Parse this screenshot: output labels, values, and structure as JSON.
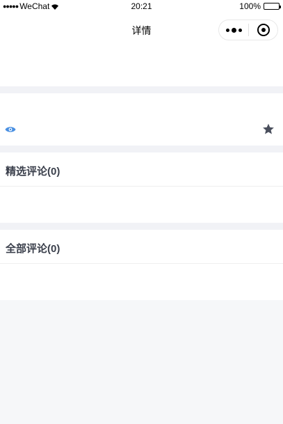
{
  "status_bar": {
    "signal": "●●●●●",
    "carrier": "WeChat",
    "time": "20:21",
    "battery": "100%"
  },
  "nav": {
    "title": "详情"
  },
  "sections": {
    "featured_comments": "精选评论(0)",
    "all_comments": "全部评论(0)"
  },
  "colors": {
    "accent": "#4a90e2",
    "title_text": "#3a3f4b",
    "star": "#4a4f5c"
  },
  "icons": {
    "view": "eye-icon",
    "favorite": "star-icon"
  }
}
